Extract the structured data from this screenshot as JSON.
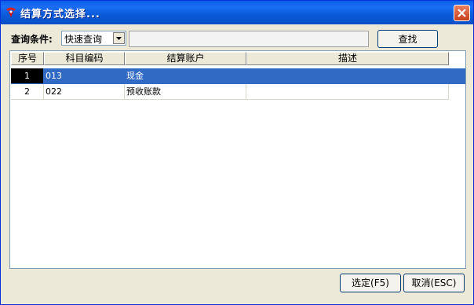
{
  "window": {
    "title": "结算方式选择...",
    "colors": {
      "titlebar": "#0a5fe7",
      "selection": "#316ac5",
      "face": "#ece9d8"
    }
  },
  "icons": {
    "app": "app-logo-icon",
    "close": "close-icon",
    "dropdown": "chevron-down-icon"
  },
  "query": {
    "label": "查询条件:",
    "mode_selected": "快速查询",
    "search_value": "",
    "search_button": "查找"
  },
  "table": {
    "columns": [
      "序号",
      "科目编码",
      "结算账户",
      "描述"
    ],
    "rows": [
      {
        "index": "1",
        "code": "013",
        "account": "现金",
        "description": "",
        "selected": true
      },
      {
        "index": "2",
        "code": "022",
        "account": "预收账款",
        "description": "",
        "selected": false
      }
    ]
  },
  "footer": {
    "select_button": "选定(F5)",
    "cancel_button": "取消(ESC)"
  }
}
